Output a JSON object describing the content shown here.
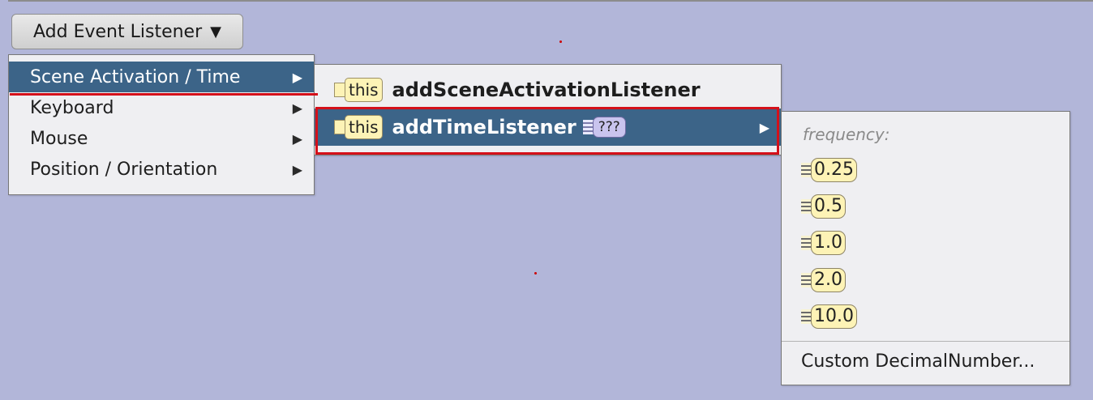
{
  "button": {
    "label": "Add Event Listener",
    "caret": "▼"
  },
  "category_menu": {
    "items": [
      {
        "label": "Scene Activation / Time",
        "selected": true
      },
      {
        "label": "Keyboard",
        "selected": false
      },
      {
        "label": "Mouse",
        "selected": false
      },
      {
        "label": "Position / Orientation",
        "selected": false
      }
    ],
    "submenu_arrow": "▶"
  },
  "method_menu": {
    "items": [
      {
        "target": "this",
        "method": "addSceneActivationListener",
        "selected": false
      },
      {
        "target": "this",
        "method": "addTimeListener",
        "argument": "???",
        "selected": true
      }
    ]
  },
  "value_menu": {
    "header": "frequency:",
    "values": [
      "0.25",
      "0.5",
      "1.0",
      "2.0",
      "10.0"
    ],
    "custom": "Custom DecimalNumber..."
  },
  "colors": {
    "background": "#b2b6d9",
    "selection": "#3c6488",
    "highlight": "#d4101a",
    "tile_yellow": "#fdf3b6",
    "tile_purple": "#c9c4ee"
  }
}
